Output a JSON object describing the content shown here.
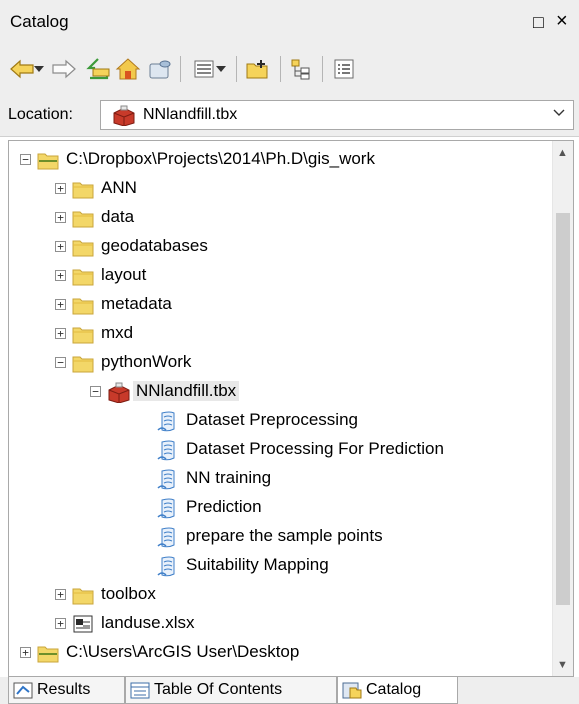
{
  "window": {
    "title": "Catalog",
    "maximize_glyph": "□",
    "close_glyph": "×"
  },
  "toolbar": {
    "tools": [
      "back-icon",
      "dropdown-arrow-icon",
      "forward-icon",
      "up-one-level-icon",
      "home-icon",
      "connect-database-icon",
      "view-options-icon",
      "dropdown-arrow-icon",
      "new-folder-icon",
      "tree-view-icon",
      "details-view-icon"
    ]
  },
  "location": {
    "label": "Location:",
    "value": "NNlandfill.tbx"
  },
  "tree": {
    "items": [
      {
        "label": "C:\\Dropbox\\Projects\\2014\\Ph.D\\gis_work",
        "icon": "folder-connection-icon",
        "expander": "−"
      },
      {
        "label": "ANN",
        "icon": "folder-icon",
        "expander": "+"
      },
      {
        "label": "data",
        "icon": "folder-icon",
        "expander": "+"
      },
      {
        "label": "geodatabases",
        "icon": "folder-icon",
        "expander": "+"
      },
      {
        "label": "layout",
        "icon": "folder-icon",
        "expander": "+"
      },
      {
        "label": "metadata",
        "icon": "folder-icon",
        "expander": "+"
      },
      {
        "label": "mxd",
        "icon": "folder-icon",
        "expander": "+"
      },
      {
        "label": "pythonWork",
        "icon": "folder-icon",
        "expander": "−"
      },
      {
        "label": "NNlandfill.tbx",
        "icon": "toolbox-icon",
        "expander": "−"
      },
      {
        "label": "Dataset Preprocessing",
        "icon": "script-tool-icon",
        "expander": ""
      },
      {
        "label": "Dataset Processing For Prediction",
        "icon": "script-tool-icon",
        "expander": ""
      },
      {
        "label": "NN training",
        "icon": "script-tool-icon",
        "expander": ""
      },
      {
        "label": "Prediction",
        "icon": "script-tool-icon",
        "expander": ""
      },
      {
        "label": "prepare the sample points",
        "icon": "script-tool-icon",
        "expander": ""
      },
      {
        "label": "Suitability Mapping",
        "icon": "script-tool-icon",
        "expander": ""
      },
      {
        "label": "toolbox",
        "icon": "folder-icon",
        "expander": "+"
      },
      {
        "label": "landuse.xlsx",
        "icon": "spreadsheet-icon",
        "expander": "+"
      },
      {
        "label": "C:\\Users\\ArcGIS User\\Desktop",
        "icon": "folder-connection-icon",
        "expander": "+"
      }
    ]
  },
  "tabs": [
    {
      "label": "Results",
      "icon": "results-icon"
    },
    {
      "label": "Table Of Contents",
      "icon": "table-of-contents-icon"
    },
    {
      "label": "Catalog",
      "icon": "catalog-icon"
    }
  ],
  "colors": {
    "folder": "#f3d768",
    "folder_edge": "#c9a43a",
    "toolbox": "#c83a2a",
    "script": "#3f7fc8",
    "chrome": "#eeeeee"
  }
}
